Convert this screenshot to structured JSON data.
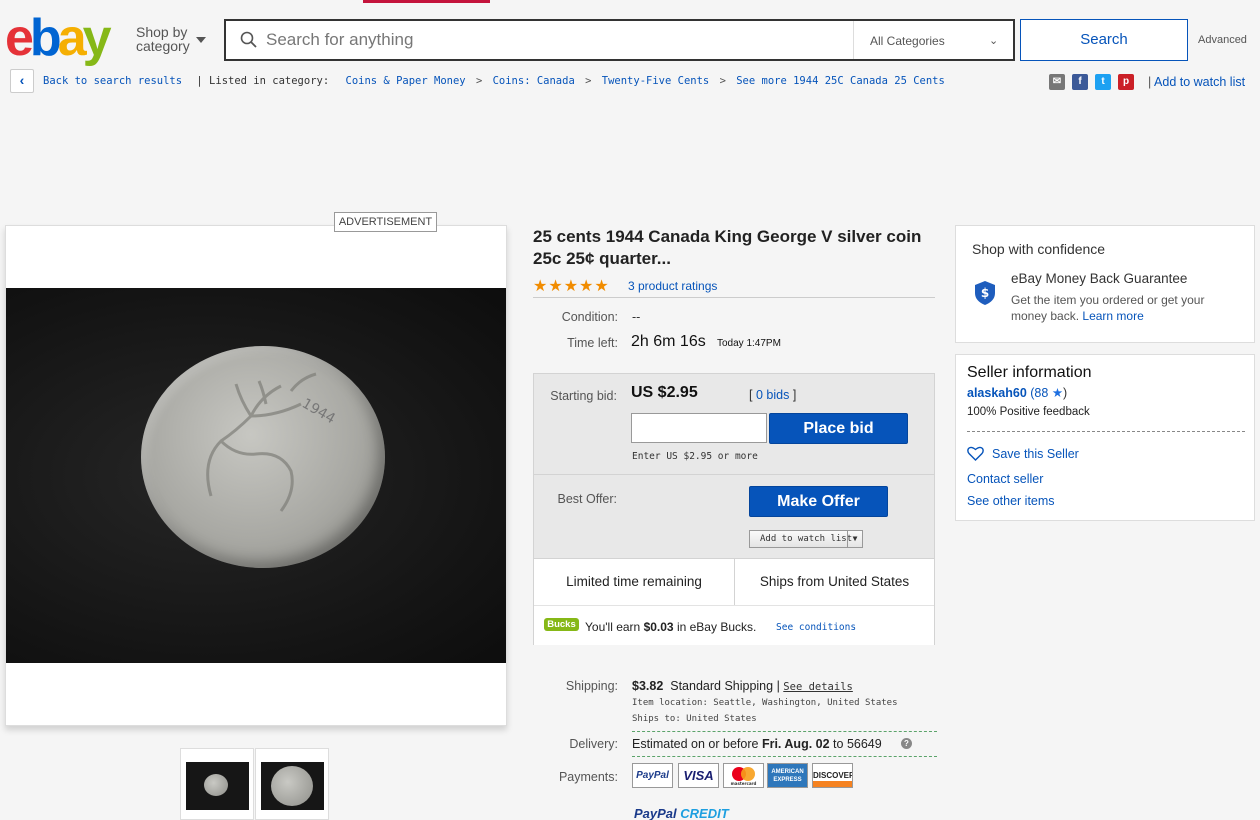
{
  "header": {
    "logo": [
      "e",
      "b",
      "a",
      "y"
    ],
    "shop_by_line1": "Shop by",
    "shop_by_line2": "category",
    "search_placeholder": "Search for anything",
    "category_selected": "All Categories",
    "search_button": "Search",
    "advanced": "Advanced"
  },
  "breadcrumb": {
    "back": "Back to search results",
    "listed_in": "| Listed in category:",
    "items": [
      "Coins & Paper Money",
      "Coins: Canada",
      "Twenty-Five Cents",
      "See more 1944 25C Canada 25 Cents"
    ],
    "separator": ">"
  },
  "share": {
    "icons": [
      "email-icon",
      "facebook-icon",
      "twitter-icon",
      "pinterest-icon"
    ],
    "watch_divider": "|",
    "add_to_watch": "Add to watch list"
  },
  "ad": {
    "label": "ADVERTISEMENT"
  },
  "listing": {
    "title": "25 cents 1944 Canada King George V silver coin 25c 25¢ quarter...",
    "stars": "★★★★★",
    "rating_count": "3 product ratings",
    "condition_label": "Condition:",
    "condition_value": "--",
    "time_left_label": "Time left:",
    "time_left_value": "2h 6m 16s",
    "end_time": "Today 1:47PM"
  },
  "bid": {
    "starting_label": "Starting bid:",
    "price": "US $2.95",
    "bids_open": "[",
    "bids_link": "0 bids",
    "bids_close": "]",
    "place_bid": "Place bid",
    "hint": "Enter US $2.95 or more",
    "best_offer_label": "Best Offer:",
    "make_offer": "Make Offer",
    "add_watch": "Add to watch list",
    "limited": "Limited time remaining",
    "ships_from": "Ships from United States",
    "bucks_badge": "Bucks",
    "bucks_pre": "You'll earn",
    "bucks_amount": "$0.03",
    "bucks_post": "in eBay Bucks.",
    "see_conditions": "See conditions"
  },
  "shipping": {
    "label": "Shipping:",
    "cost": "$3.82",
    "method": "Standard Shipping |",
    "see_details": "See details",
    "item_location": "Item location:  Seattle, Washington, United States",
    "ships_to": "Ships to:  United States",
    "delivery_label": "Delivery:",
    "delivery_pre": "Estimated on or before",
    "delivery_date": "Fri. Aug. 02",
    "delivery_post": "to 56649",
    "payments_label": "Payments:",
    "payment_methods": [
      "PayPal",
      "VISA",
      "mastercard",
      "AMERICAN EXPRESS",
      "DISCOVER"
    ],
    "paypal_credit_a": "PayPal",
    "paypal_credit_b": "CREDIT"
  },
  "confidence": {
    "title": "Shop with confidence",
    "guarantee": "eBay Money Back Guarantee",
    "text": "Get the item you ordered or get your money back.",
    "learn_more": "Learn more"
  },
  "seller": {
    "title": "Seller information",
    "name": "alaskah60",
    "score_open": "(88",
    "score_close": ")",
    "feedback": "100% Positive feedback",
    "save": "Save this Seller",
    "contact": "Contact seller",
    "other": "See other items"
  },
  "colors": {
    "accent_blue": "#0654ba",
    "star_orange": "#f18c00",
    "bucks_green": "#86b817"
  }
}
